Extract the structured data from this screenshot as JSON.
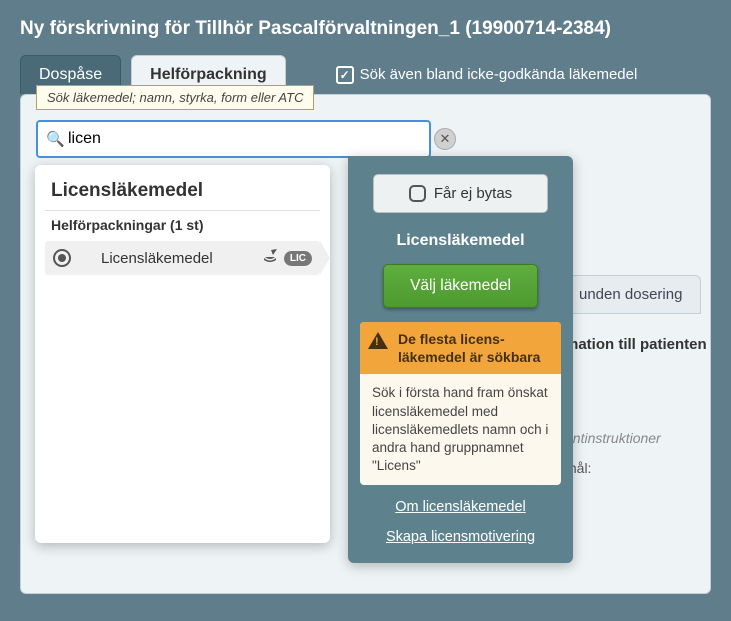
{
  "header": {
    "title": "Ny förskrivning för Tillhör Pascalförvaltningen_1 (19900714-2384)"
  },
  "tabs": {
    "dospase": "Dospåse",
    "helfp": "Helförpackning"
  },
  "search": {
    "checkbox_label": "Sök även bland icke-godkända läkemedel",
    "tooltip": "Sök läkemedel; namn, styrka, form eller ATC",
    "value": "licen"
  },
  "dropdown": {
    "title": "Licensläkemedel",
    "subheader": "Helförpackningar (1 st)",
    "item_label": "Licensläkemedel",
    "lic_badge": "LIC"
  },
  "info": {
    "far_ej": "Får ej bytas",
    "title": "Licensläkemedel",
    "choose": "Välj läkemedel",
    "warn_title": "De flesta licens­läkemedel är sökbara",
    "warn_body": "Sök i första hand fram önskat licensläkemedel med licensläkemedlets namn och i andra hand gruppnamnet \"Licens\"",
    "link1": "Om licensläkemedel",
    "link2": "Skapa licensmotivering"
  },
  "bg": {
    "tab": "unden dosering",
    "line1": "mation till patienten",
    "line2": "entinstruktioner",
    "line3": "mål:"
  }
}
